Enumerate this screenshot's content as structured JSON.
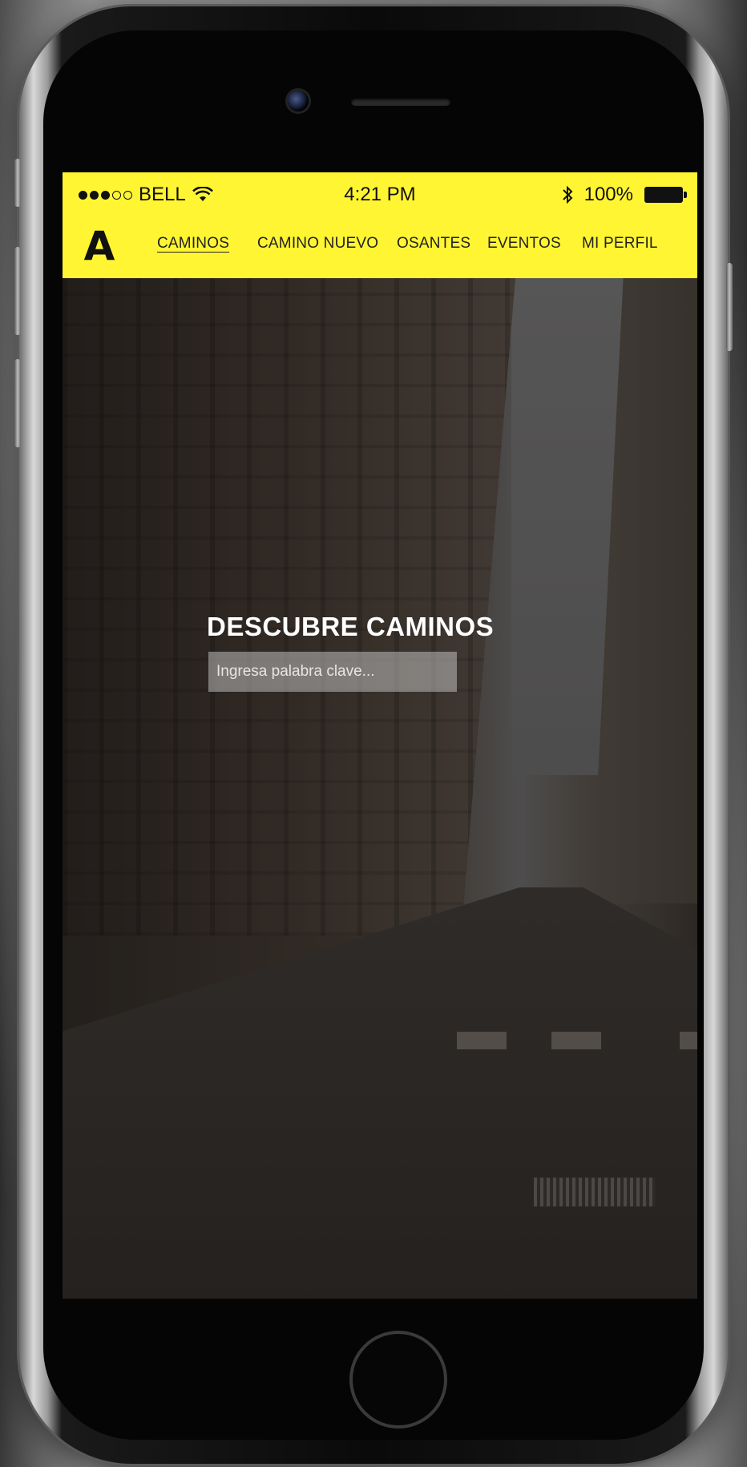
{
  "statusbar": {
    "carrier": "BELL",
    "time": "4:21 PM",
    "battery": "100%",
    "icons": [
      "signal-dots-icon",
      "wifi-icon",
      "bluetooth-icon",
      "battery-icon"
    ]
  },
  "navbar": {
    "logo": "A",
    "items": [
      {
        "label": "CAMINOS",
        "active": true
      },
      {
        "label": "CAMINO NUEVO",
        "active": false
      },
      {
        "label": "OSANTES",
        "active": false
      },
      {
        "label": "EVENTOS",
        "active": false
      },
      {
        "label": "MI PERFIL",
        "active": false
      }
    ]
  },
  "hero": {
    "title": "DESCUBRE CAMINOS",
    "search_placeholder": "Ingresa palabra clave...",
    "search_value": ""
  },
  "colors": {
    "header_bg": "#fff533",
    "text_dark": "#111111",
    "hero_text": "#ffffff"
  }
}
